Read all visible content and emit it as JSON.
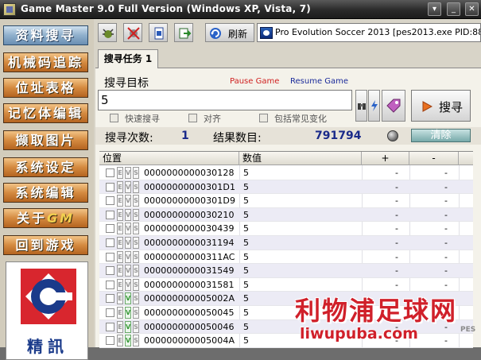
{
  "window": {
    "title": "Game Master 9.0 Full Version (Windows XP, Vista, 7)"
  },
  "sidebar": {
    "items": [
      {
        "label": "资料搜寻",
        "active": true
      },
      {
        "label": "机械码追踪"
      },
      {
        "label": "位址表格"
      },
      {
        "label": "记忆体编辑"
      },
      {
        "label": "撷取图片"
      },
      {
        "label": "系统设定"
      },
      {
        "label": "系统编辑"
      },
      {
        "label": "关于",
        "suffix": "GM"
      },
      {
        "label": "回到游戏"
      }
    ],
    "brand": "精訊"
  },
  "toolbar": {
    "refresh_label": "刷新",
    "process": "Pro Evolution Soccer 2013  [pes2013.exe PID:880]"
  },
  "tab": {
    "label": "搜寻任务 1"
  },
  "search": {
    "target_label": "搜寻目标",
    "pause_label": "Pause Game",
    "resume_label": "Resume Game",
    "value": "5",
    "button_label": "搜寻",
    "options": [
      "快速搜寻",
      "对齐",
      "包括常见变化"
    ]
  },
  "stats": {
    "count_label": "搜寻次数:",
    "count_value": "1",
    "results_label": "结果数目:",
    "results_value": "791794",
    "clear_label": "清除"
  },
  "table": {
    "headers": [
      "位置",
      "数值",
      "+",
      "-"
    ],
    "flag_letters": [
      "E",
      "V",
      "S"
    ],
    "rows": [
      {
        "addr": "0000000000030128",
        "value": "5",
        "plus": "-",
        "minus": "-",
        "v_on": false
      },
      {
        "addr": "00000000000301D1",
        "value": "5",
        "plus": "-",
        "minus": "-",
        "v_on": false
      },
      {
        "addr": "00000000000301D9",
        "value": "5",
        "plus": "-",
        "minus": "-",
        "v_on": false
      },
      {
        "addr": "0000000000030210",
        "value": "5",
        "plus": "-",
        "minus": "-",
        "v_on": false
      },
      {
        "addr": "0000000000030439",
        "value": "5",
        "plus": "-",
        "minus": "-",
        "v_on": false
      },
      {
        "addr": "0000000000031194",
        "value": "5",
        "plus": "-",
        "minus": "-",
        "v_on": false
      },
      {
        "addr": "00000000000311AC",
        "value": "5",
        "plus": "-",
        "minus": "-",
        "v_on": false
      },
      {
        "addr": "0000000000031549",
        "value": "5",
        "plus": "-",
        "minus": "-",
        "v_on": false
      },
      {
        "addr": "0000000000031581",
        "value": "5",
        "plus": "-",
        "minus": "-",
        "v_on": false
      },
      {
        "addr": "000000000005002A",
        "value": "5",
        "plus": "-",
        "minus": "-",
        "v_on": true
      },
      {
        "addr": "0000000000050045",
        "value": "5",
        "plus": "-",
        "minus": "-",
        "v_on": true
      },
      {
        "addr": "0000000000050046",
        "value": "5",
        "plus": "-",
        "minus": "-",
        "v_on": true
      },
      {
        "addr": "000000000005004A",
        "value": "5",
        "plus": "-",
        "minus": "-",
        "v_on": true
      }
    ]
  },
  "watermark": {
    "chinese": "利物浦足球网",
    "url": "liwupuba.com",
    "logo": "PES"
  },
  "colors": {
    "sidebar_orange": "#d48a40",
    "sidebar_active": "#8fb0cc",
    "stat_blue": "#1a2a8a",
    "pause_red": "#d02020",
    "resume_blue": "#1a2a9a",
    "watermark_red": "#d0202a"
  }
}
